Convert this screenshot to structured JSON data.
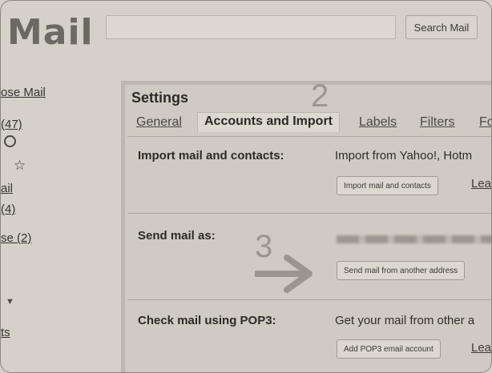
{
  "header": {
    "logo_text": "Mail",
    "search_button_label": "Search Mail"
  },
  "sidebar": {
    "items": [
      {
        "label": "ose Mail"
      },
      {
        "label": "(47)"
      },
      {
        "label": "ail"
      },
      {
        "label": "(4)"
      },
      {
        "label": "se (2)"
      },
      {
        "label": "ts"
      }
    ]
  },
  "settings": {
    "title": "Settings",
    "step_numbers": [
      "2",
      "3"
    ],
    "tabs": [
      {
        "label": "General"
      },
      {
        "label": "Accounts and Import"
      },
      {
        "label": "Labels"
      },
      {
        "label": "Filters"
      },
      {
        "label": "Fo"
      }
    ],
    "rows": [
      {
        "label": "Import mail and contacts:",
        "description": "Import from Yahoo!, Hotm",
        "button": "Import mail and contacts",
        "link": "Lea"
      },
      {
        "label": "Send mail as:",
        "button": "Send mail from another address"
      },
      {
        "label": "Check mail using POP3:",
        "description": "Get your mail from other a",
        "button": "Add POP3 email account",
        "link": "Lea"
      }
    ]
  }
}
